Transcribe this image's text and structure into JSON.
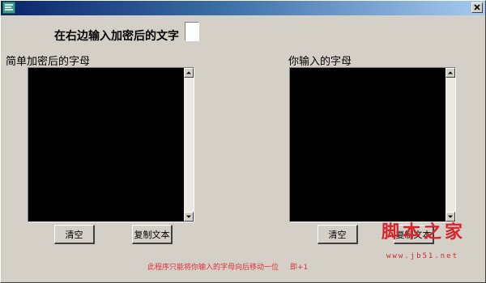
{
  "window": {
    "colors": {
      "face": "#d4d0c8",
      "titlebar_start": "#0a246a",
      "titlebar_end": "#a6caf0",
      "textarea_bg": "#000000",
      "footer": "#e0303a",
      "watermark": "#d8242b"
    },
    "icons": {
      "app": "app-icon",
      "close": "close-icon"
    }
  },
  "form": {
    "prompt": "在右边输入加密后的文字",
    "key_value": ""
  },
  "left_panel": {
    "label": "简单加密后的字母",
    "text": "",
    "clear_label": "清空",
    "copy_label": "复制文本"
  },
  "right_panel": {
    "label": "你输入的字母",
    "text": "",
    "clear_label": "清空",
    "copy_label": "复制文本"
  },
  "footer": {
    "note": "此程序只能将你输入的字母向后移动一位",
    "note_suffix": "即+1"
  },
  "watermark": {
    "title": "脚本之家",
    "url": "www.jb51.net"
  }
}
